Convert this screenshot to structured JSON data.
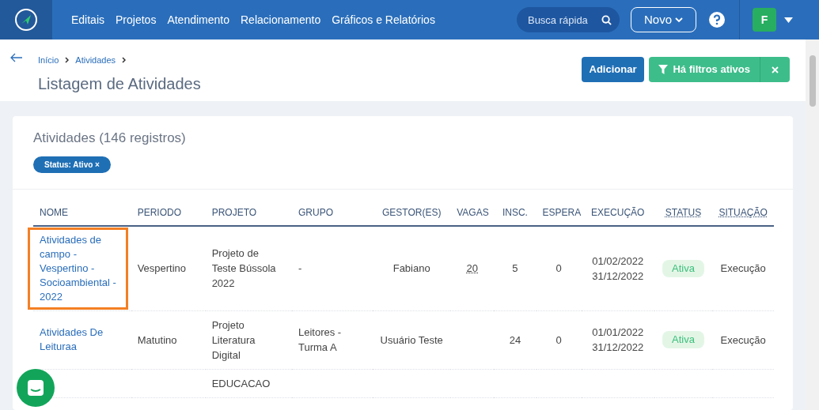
{
  "nav": {
    "items": [
      "Editais",
      "Projetos",
      "Atendimento",
      "Relacionamento",
      "Gráficos e Relatórios"
    ],
    "search": {
      "placeholder": "Busca rápida"
    },
    "new_button": "Novo",
    "avatar": "F"
  },
  "breadcrumb": [
    "Início",
    "Atividades"
  ],
  "page_title": "Listagem de Atividades",
  "actions": {
    "add": "Adicionar",
    "filters": "Há filtros ativos"
  },
  "card": {
    "title": "Atividades (146 registros)",
    "filter_tag": "Status: Ativo ×"
  },
  "table": {
    "columns": [
      {
        "label": "NOME",
        "underlined": false
      },
      {
        "label": "PERIODO",
        "underlined": false
      },
      {
        "label": "PROJETO",
        "underlined": false
      },
      {
        "label": "GRUPO",
        "underlined": false
      },
      {
        "label": "GESTOR(ES)",
        "underlined": false
      },
      {
        "label": "VAGAS",
        "underlined": false
      },
      {
        "label": "INSC.",
        "underlined": false
      },
      {
        "label": "ESPERA",
        "underlined": false
      },
      {
        "label": "EXECUÇÃO",
        "underlined": false
      },
      {
        "label": "STATUS",
        "underlined": true
      },
      {
        "label": "SITUAÇÃO",
        "underlined": true
      }
    ],
    "rows": [
      {
        "highlighted": true,
        "nome": "Atividades de campo - Vespertino - Socioambiental - 2022",
        "periodo": "Vespertino",
        "projeto": "Projeto de Teste Bússola 2022",
        "grupo": "-",
        "gestor": "Fabiano",
        "vagas": "20",
        "insc": "5",
        "espera": "0",
        "inicio": "01/02/2022",
        "fim": "31/12/2022",
        "status": "Ativa",
        "situacao": "Execução"
      },
      {
        "nome": "Atividades De Leituraa",
        "periodo": "Matutino",
        "projeto": "Projeto Literatura Digital",
        "grupo": "Leitores - Turma A",
        "gestor": "Usuário Teste",
        "insc": "24",
        "espera": "0",
        "inicio": "01/01/2022",
        "fim": "31/12/2022",
        "status": "Ativa",
        "situacao": "Execução"
      },
      {
        "projeto": "EDUCACAO"
      }
    ]
  }
}
